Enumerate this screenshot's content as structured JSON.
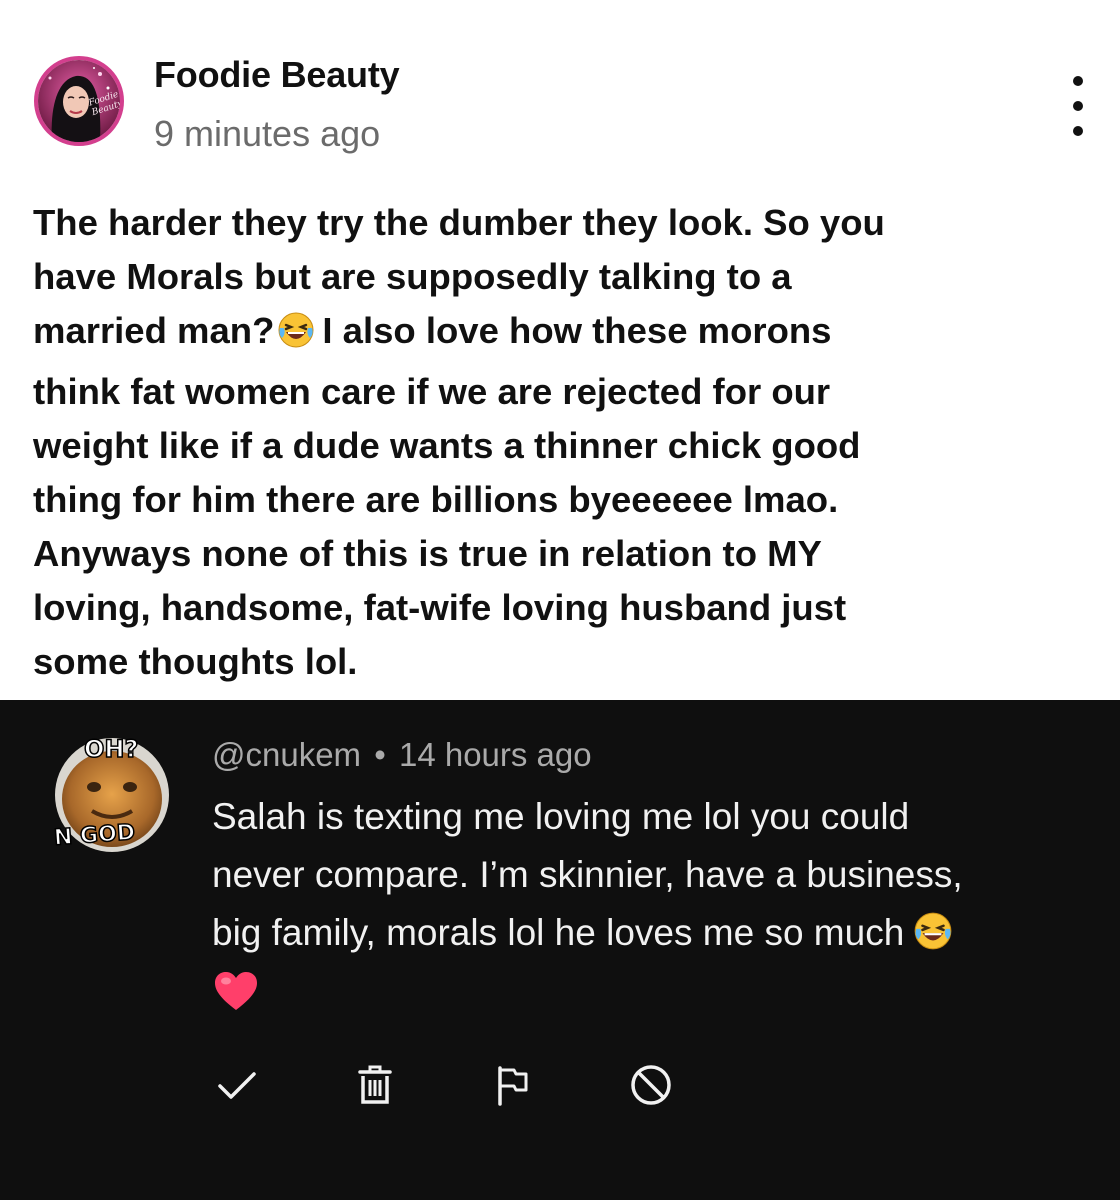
{
  "post": {
    "author": "Foodie Beauty",
    "time": "9 minutes ago",
    "text_lines": [
      "The harder they try the dumber they look. So you",
      "have Morals but are supposedly talking to a",
      "married man?",
      "I also love how these morons",
      "think fat women care if we are rejected for our",
      "weight like if a dude wants a thinner chick good",
      "thing for him there are billions byeeeeee lmao.",
      "Anyways none of this is true in relation to MY",
      "loving, handsome, fat-wife loving husband just",
      "some thoughts lol."
    ],
    "avatar_logo_text": "Foodie Beauty",
    "menu_icon": "more-vertical-icon",
    "emoji": "face-with-tears-of-joy"
  },
  "comment": {
    "avatar_text_top": "OH?",
    "avatar_text_bottom": "N GOD",
    "handle": "@cnukem",
    "separator": "•",
    "time": "14 hours ago",
    "text_lines": [
      "Salah is texting me loving me lol you could",
      "never compare. I’m skinnier, have a business,",
      "big family, morals lol he loves me so much"
    ],
    "emoji": "face-with-tears-of-joy",
    "heart_icon": "heart-icon",
    "actions": [
      "check-icon",
      "trash-icon",
      "flag-icon",
      "block-icon"
    ]
  },
  "colors": {
    "post_bg": "#ffffff",
    "post_text": "#111111",
    "post_meta": "#6b6b6b",
    "comment_bg": "#0f0f0f",
    "comment_text": "#f1f1f1",
    "comment_meta": "#aaaaaa",
    "avatar_ring": "#d33f8e",
    "heart": "#ff3f6a",
    "emoji_yellow": "#f9c335"
  }
}
